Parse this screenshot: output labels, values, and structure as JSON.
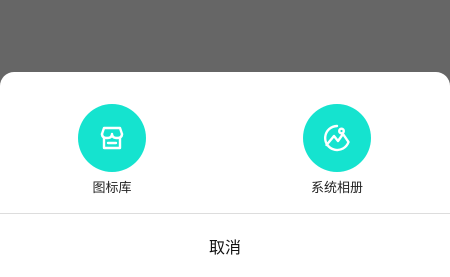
{
  "colors": {
    "overlay": "#666666",
    "sheet_bg": "#ffffff",
    "accent": "#15e3cf",
    "divider": "#dddddd",
    "text": "#222222"
  },
  "options": [
    {
      "label": "图标库",
      "icon": "storefront-icon"
    },
    {
      "label": "系统相册",
      "icon": "image-gallery-icon"
    }
  ],
  "cancel_label": "取消"
}
